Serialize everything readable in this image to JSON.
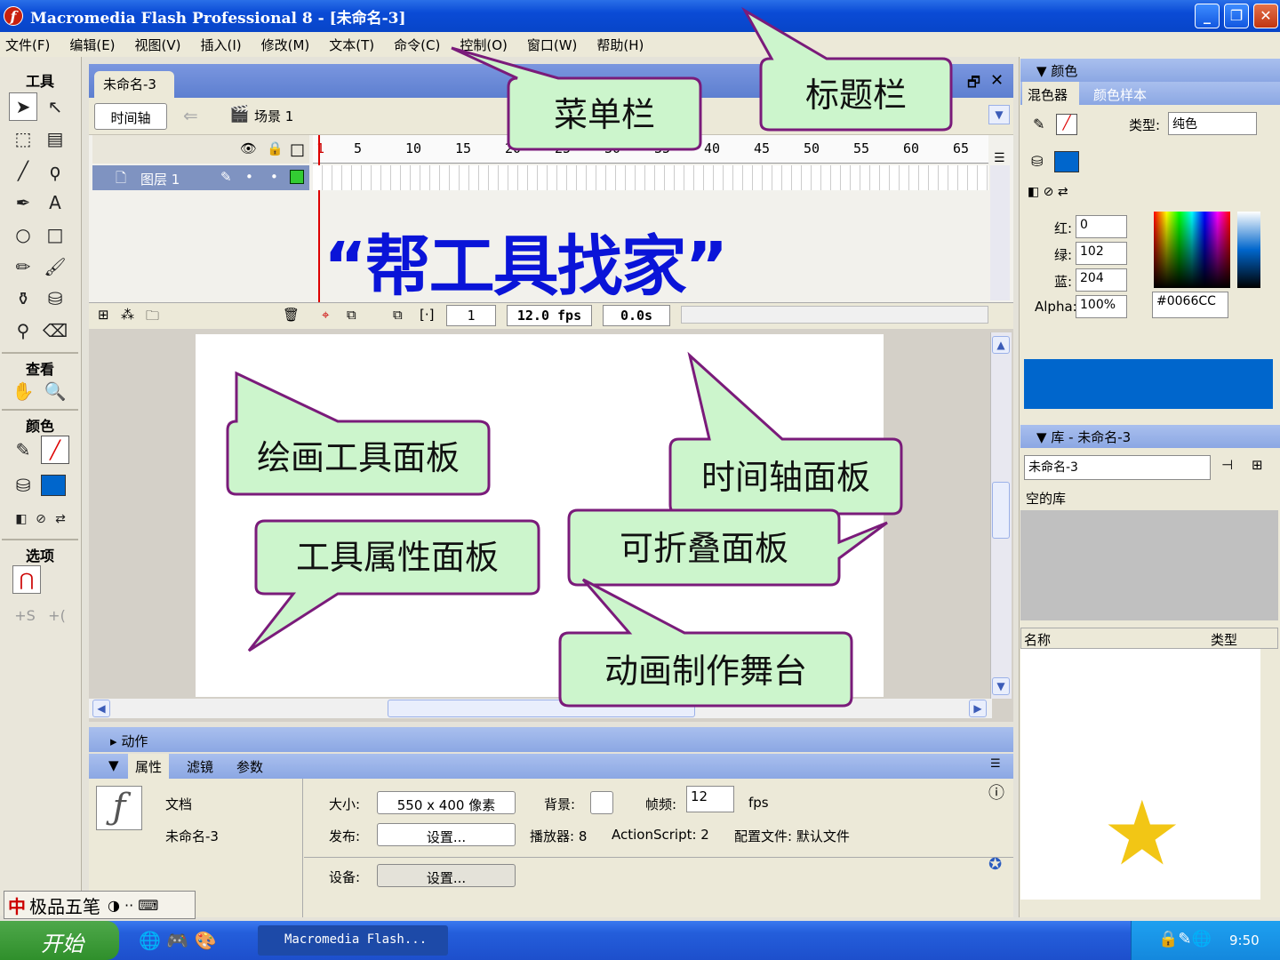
{
  "window": {
    "title": "Macromedia Flash Professional 8 - [未命名-3]",
    "min": "_",
    "max": "❐",
    "close": "✕"
  },
  "menu": [
    "文件(F)",
    "编辑(E)",
    "视图(V)",
    "插入(I)",
    "修改(M)",
    "文本(T)",
    "命令(C)",
    "控制(O)",
    "窗口(W)",
    "帮助(H)"
  ],
  "tools": {
    "title": "工具",
    "view_title": "查看",
    "color_title": "颜色",
    "options_title": "选项"
  },
  "document": {
    "tab": "未命名-3",
    "timeline_button": "时间轴",
    "scene": "场景 1"
  },
  "timeline": {
    "ruler": [
      "1",
      "5",
      "10",
      "15",
      "20",
      "25",
      "30",
      "35",
      "40",
      "45",
      "50",
      "55",
      "60",
      "65"
    ],
    "layer_name": "图层 1",
    "frame": "1",
    "fps": "12.0 fps",
    "time": "0.0s"
  },
  "slide_title": "“帮工具找家”",
  "callouts": {
    "title_bar": "标题栏",
    "menu_bar": "菜单栏",
    "drawing_tools": "绘画工具面板",
    "timeline_panel": "时间轴面板",
    "tool_properties": "工具属性面板",
    "collapsible_panel": "可折叠面板",
    "stage": "动画制作舞台"
  },
  "panels": {
    "actions": "动作",
    "properties": "属性",
    "filters": "滤镜",
    "params": "参数"
  },
  "properties": {
    "doc_type": "文档",
    "doc_name": "未命名-3",
    "size_label": "大小:",
    "size_value": "550 x 400 像素",
    "bg_label": "背景:",
    "fps_label": "帧频:",
    "fps_value": "12",
    "fps_unit": "fps",
    "publish_label": "发布:",
    "settings_btn": "设置...",
    "player_label": "播放器: 8",
    "as_label": "ActionScript: 2",
    "profile_label": "配置文件: 默认文件",
    "device_label": "设备:",
    "device_btn": "设置..."
  },
  "color_panel": {
    "title": "颜色",
    "tab_mixer": "混色器",
    "tab_swatches": "颜色样本",
    "type_label": "类型:",
    "type_value": "纯色",
    "red_label": "红:",
    "red": "0",
    "green_label": "绿:",
    "green": "102",
    "blue_label": "蓝:",
    "blue": "204",
    "alpha_label": "Alpha:",
    "alpha": "100%",
    "hex": "#0066CC",
    "fill_color": "#0066cc"
  },
  "library": {
    "title": "库 - 未命名-3",
    "select": "未命名-3",
    "empty": "空的库",
    "col_name": "名称",
    "col_type": "类型"
  },
  "taskbar": {
    "start": "开始",
    "item": "Macromedia Flash...",
    "time": "9:50"
  },
  "ime": {
    "name": "极品五笔"
  }
}
